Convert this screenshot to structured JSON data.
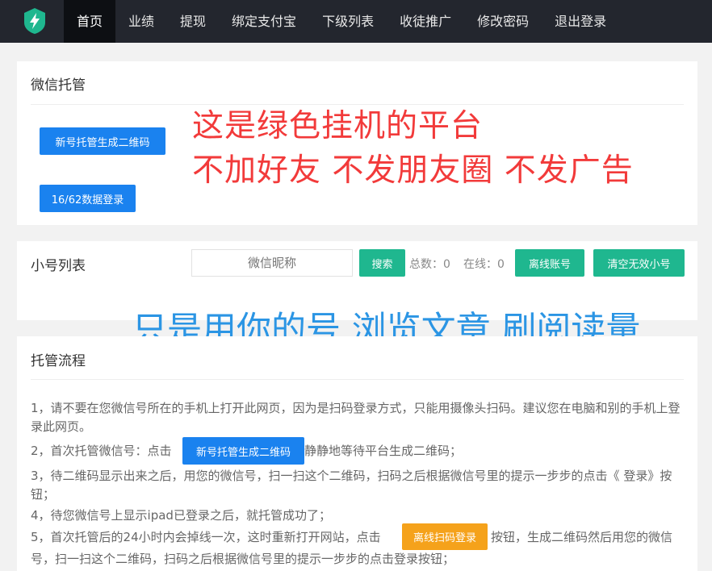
{
  "nav": {
    "items": [
      "首页",
      "业绩",
      "提现",
      "绑定支付宝",
      "下级列表",
      "收徒推广",
      "修改密码",
      "退出登录"
    ],
    "active_index": 0,
    "bg_color": "#23262e",
    "logo_color": "#1fb78f"
  },
  "wechat_card": {
    "title": "微信托管",
    "new_qr_button": "新号托管生成二维码",
    "login_button": "16/62数据登录"
  },
  "overlay": {
    "red_line1": "这是绿色挂机的平台",
    "red_line2": "不加好友 不发朋友圈 不发广告",
    "blue_line": "只是用你的号 浏览文章 刷阅读量",
    "red_color": "#f23a3a",
    "blue_color": "#2b95e4"
  },
  "sub_accounts": {
    "title": "小号列表",
    "search_placeholder": "微信昵称",
    "search_button": "搜索",
    "total_label": "总数：0",
    "online_label": "在线：0",
    "offline_button": "离线账号",
    "clear_button": "清空无效小号"
  },
  "flow": {
    "title": "托管流程",
    "step1": "1，请不要在您微信号所在的手机上打开此网页，因为是扫码登录方式，只能用摄像头扫码。建议您在电脑和别的手机上登录此网页。",
    "step2_prefix": "2，首次托管微信号：点击",
    "step2_button": "新号托管生成二维码",
    "step2_suffix": "静静地等待平台生成二维码；",
    "step3": "3，待二维码显示出来之后，用您的微信号，扫一扫这个二维码，扫码之后根据微信号里的提示一步步的点击《 登录》按钮；",
    "step4": "4，待您微信号上显示ipad已登录之后，就托管成功了；",
    "step5_prefix": "5，首次托管后的24小时内会掉线一次，这时重新打开网站，点击",
    "step5_button": "离线扫码登录",
    "step5_suffix": "按钮，生成二维码然后用您的微信",
    "step5_cont": "号，扫一扫这个二维码，扫码之后根据微信号里的提示一步步的点击登录按钮；"
  }
}
